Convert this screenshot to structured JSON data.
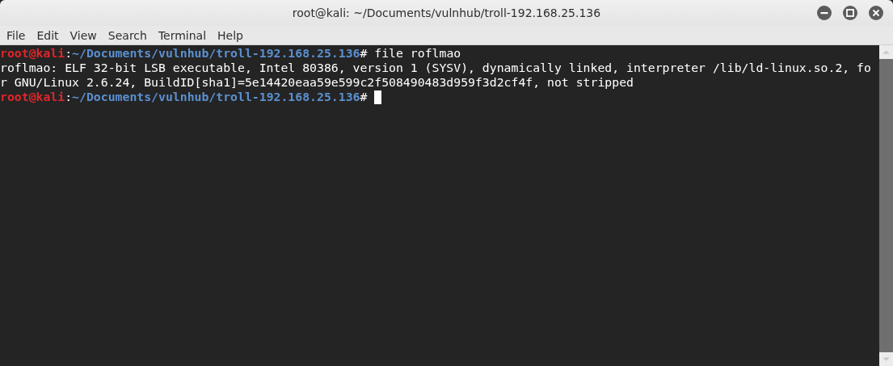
{
  "window": {
    "title": "root@kali: ~/Documents/vulnhub/troll-192.168.25.136"
  },
  "menu": [
    "File",
    "Edit",
    "View",
    "Search",
    "Terminal",
    "Help"
  ],
  "terminal": {
    "lines": [
      {
        "kind": "prompt",
        "user_host": "root@kali",
        "separator": ":",
        "path": "~/Documents/vulnhub/troll-192.168.25.136",
        "symbol": "#",
        "command": "file roflmao"
      },
      {
        "kind": "output",
        "text": "roflmao: ELF 32-bit LSB executable, Intel 80386, version 1 (SYSV), dynamically linked, interpreter /lib/ld-linux.so.2, fo"
      },
      {
        "kind": "output",
        "text": "r GNU/Linux 2.6.24, BuildID[sha1]=5e14420eaa59e599c2f508490483d959f3d2cf4f, not stripped"
      },
      {
        "kind": "prompt",
        "user_host": "root@kali",
        "separator": ":",
        "path": "~/Documents/vulnhub/troll-192.168.25.136",
        "symbol": "#",
        "cursor": true
      }
    ]
  }
}
